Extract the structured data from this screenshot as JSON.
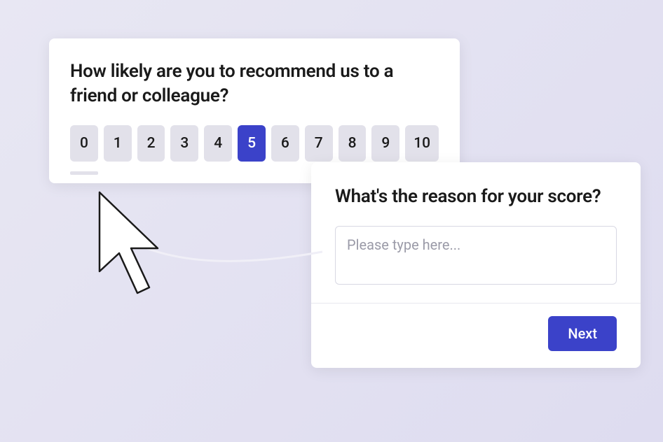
{
  "nps": {
    "question": "How likely are you to recommend us to a friend or colleague?",
    "options": [
      "0",
      "1",
      "2",
      "3",
      "4",
      "5",
      "6",
      "7",
      "8",
      "9",
      "10"
    ],
    "selected": "5"
  },
  "reason": {
    "question": "What's the reason for your score?",
    "placeholder": "Please type here...",
    "next_label": "Next"
  },
  "colors": {
    "accent": "#3b42c9",
    "button_bg": "#e2e1ea",
    "background": "#e8e7f3"
  }
}
